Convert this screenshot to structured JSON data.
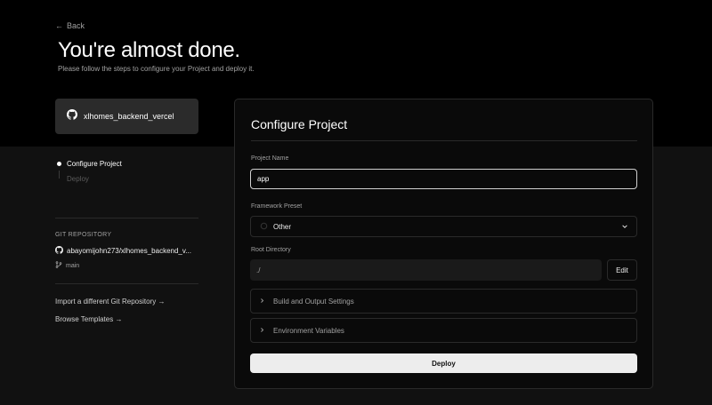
{
  "header": {
    "back_label": "Back",
    "title": "You're almost done.",
    "subtitle": "Please follow the steps to configure your Project and deploy it."
  },
  "repo_card": {
    "label": "xlhomes_backend_vercel",
    "icon": "github-icon"
  },
  "steps": [
    {
      "label": "Configure Project",
      "state": "active"
    },
    {
      "label": "Deploy",
      "state": "pending"
    }
  ],
  "git": {
    "section_label": "GIT REPOSITORY",
    "repo": "abayomijohn273/xlhomes_backend_v...",
    "branch": "main"
  },
  "side_links": {
    "import_label": "Import a different Git Repository →",
    "templates_label": "Browse Templates →"
  },
  "config": {
    "title": "Configure Project",
    "project_name_label": "Project Name",
    "project_name_value": "app",
    "framework_label": "Framework Preset",
    "framework_value": "Other",
    "root_label": "Root Directory",
    "root_value": "./",
    "edit_label": "Edit",
    "build_label": "Build and Output Settings",
    "env_label": "Environment Variables",
    "deploy_label": "Deploy"
  },
  "colors": {
    "background": "#111111",
    "header": "#000000",
    "card": "#0a0a0a",
    "button": "#ededed"
  }
}
